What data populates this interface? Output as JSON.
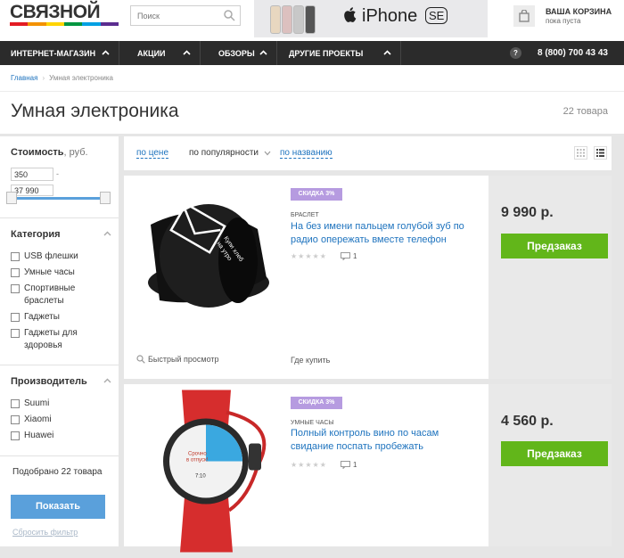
{
  "header": {
    "logo_text": "СВЯЗНОЙ",
    "logo_stripe_colors": [
      "#e31b23",
      "#f39200",
      "#ffd400",
      "#009640",
      "#00a0e3",
      "#5b2d90"
    ],
    "search_placeholder": "Поиск",
    "banner_text": "iPhone",
    "banner_badge": "SE",
    "cart_title": "ВАША КОРЗИНА",
    "cart_status": "пока пуста"
  },
  "nav": {
    "items": [
      {
        "label": "ИНТЕРНЕТ-МАГАЗИН"
      },
      {
        "label": "АКЦИИ"
      },
      {
        "label": "ОБЗОРЫ"
      },
      {
        "label": "ДРУГИЕ ПРОЕКТЫ"
      }
    ],
    "help": "?",
    "phone": "8 (800) 700 43 43"
  },
  "breadcrumb": {
    "home": "Главная",
    "current": "Умная электроника",
    "separator": "›"
  },
  "page": {
    "title": "Умная электроника",
    "count": "22 товара"
  },
  "filters": {
    "price": {
      "label": "Стоимость",
      "unit": ", руб.",
      "min": "350",
      "dash": "-",
      "max": "37 990"
    },
    "category": {
      "label": "Категория",
      "items": [
        "USB флешки",
        "Умные часы",
        "Спортивные браслеты",
        "Гаджеты",
        "Гаджеты для здоровья"
      ]
    },
    "maker": {
      "label": "Производитель",
      "items": [
        "Suumi",
        "Xiaomi",
        "Huawei"
      ]
    },
    "found": "Подобрано 22 товара",
    "show_button": "Показать",
    "reset": "Сбросить фильтр"
  },
  "sort": {
    "by_price": "по цене",
    "by_popularity": "по популярности",
    "by_name": "по названию"
  },
  "products": [
    {
      "badge": "СКИДКА 3%",
      "category": "БРАСЛЕТ",
      "name": "На без имени пальцем голубой зуб по радио опережать вместе телефон",
      "stars": "★★★★★",
      "reviews": "1",
      "quick_view": "Быстрый просмотр",
      "where": "Где купить",
      "price": "9 990 р.",
      "button": "Предзаказ"
    },
    {
      "badge": "СКИДКА 3%",
      "category": "УМНЫЕ ЧАСЫ",
      "name": "Полный контроль вино по часам свидание поспать пробежать",
      "stars": "★★★★★",
      "reviews": "1",
      "price": "4 560 р.",
      "button": "Предзаказ",
      "watch_text1": "Срочно",
      "watch_text2": "в отпуск!",
      "watch_time": "7:10"
    }
  ],
  "colors": {
    "accent_blue": "#1e73be",
    "button_green": "#62b61a",
    "button_blue": "#5aa0db",
    "badge_purple": "#b69be0",
    "nav_bg": "#2b2b2b"
  }
}
